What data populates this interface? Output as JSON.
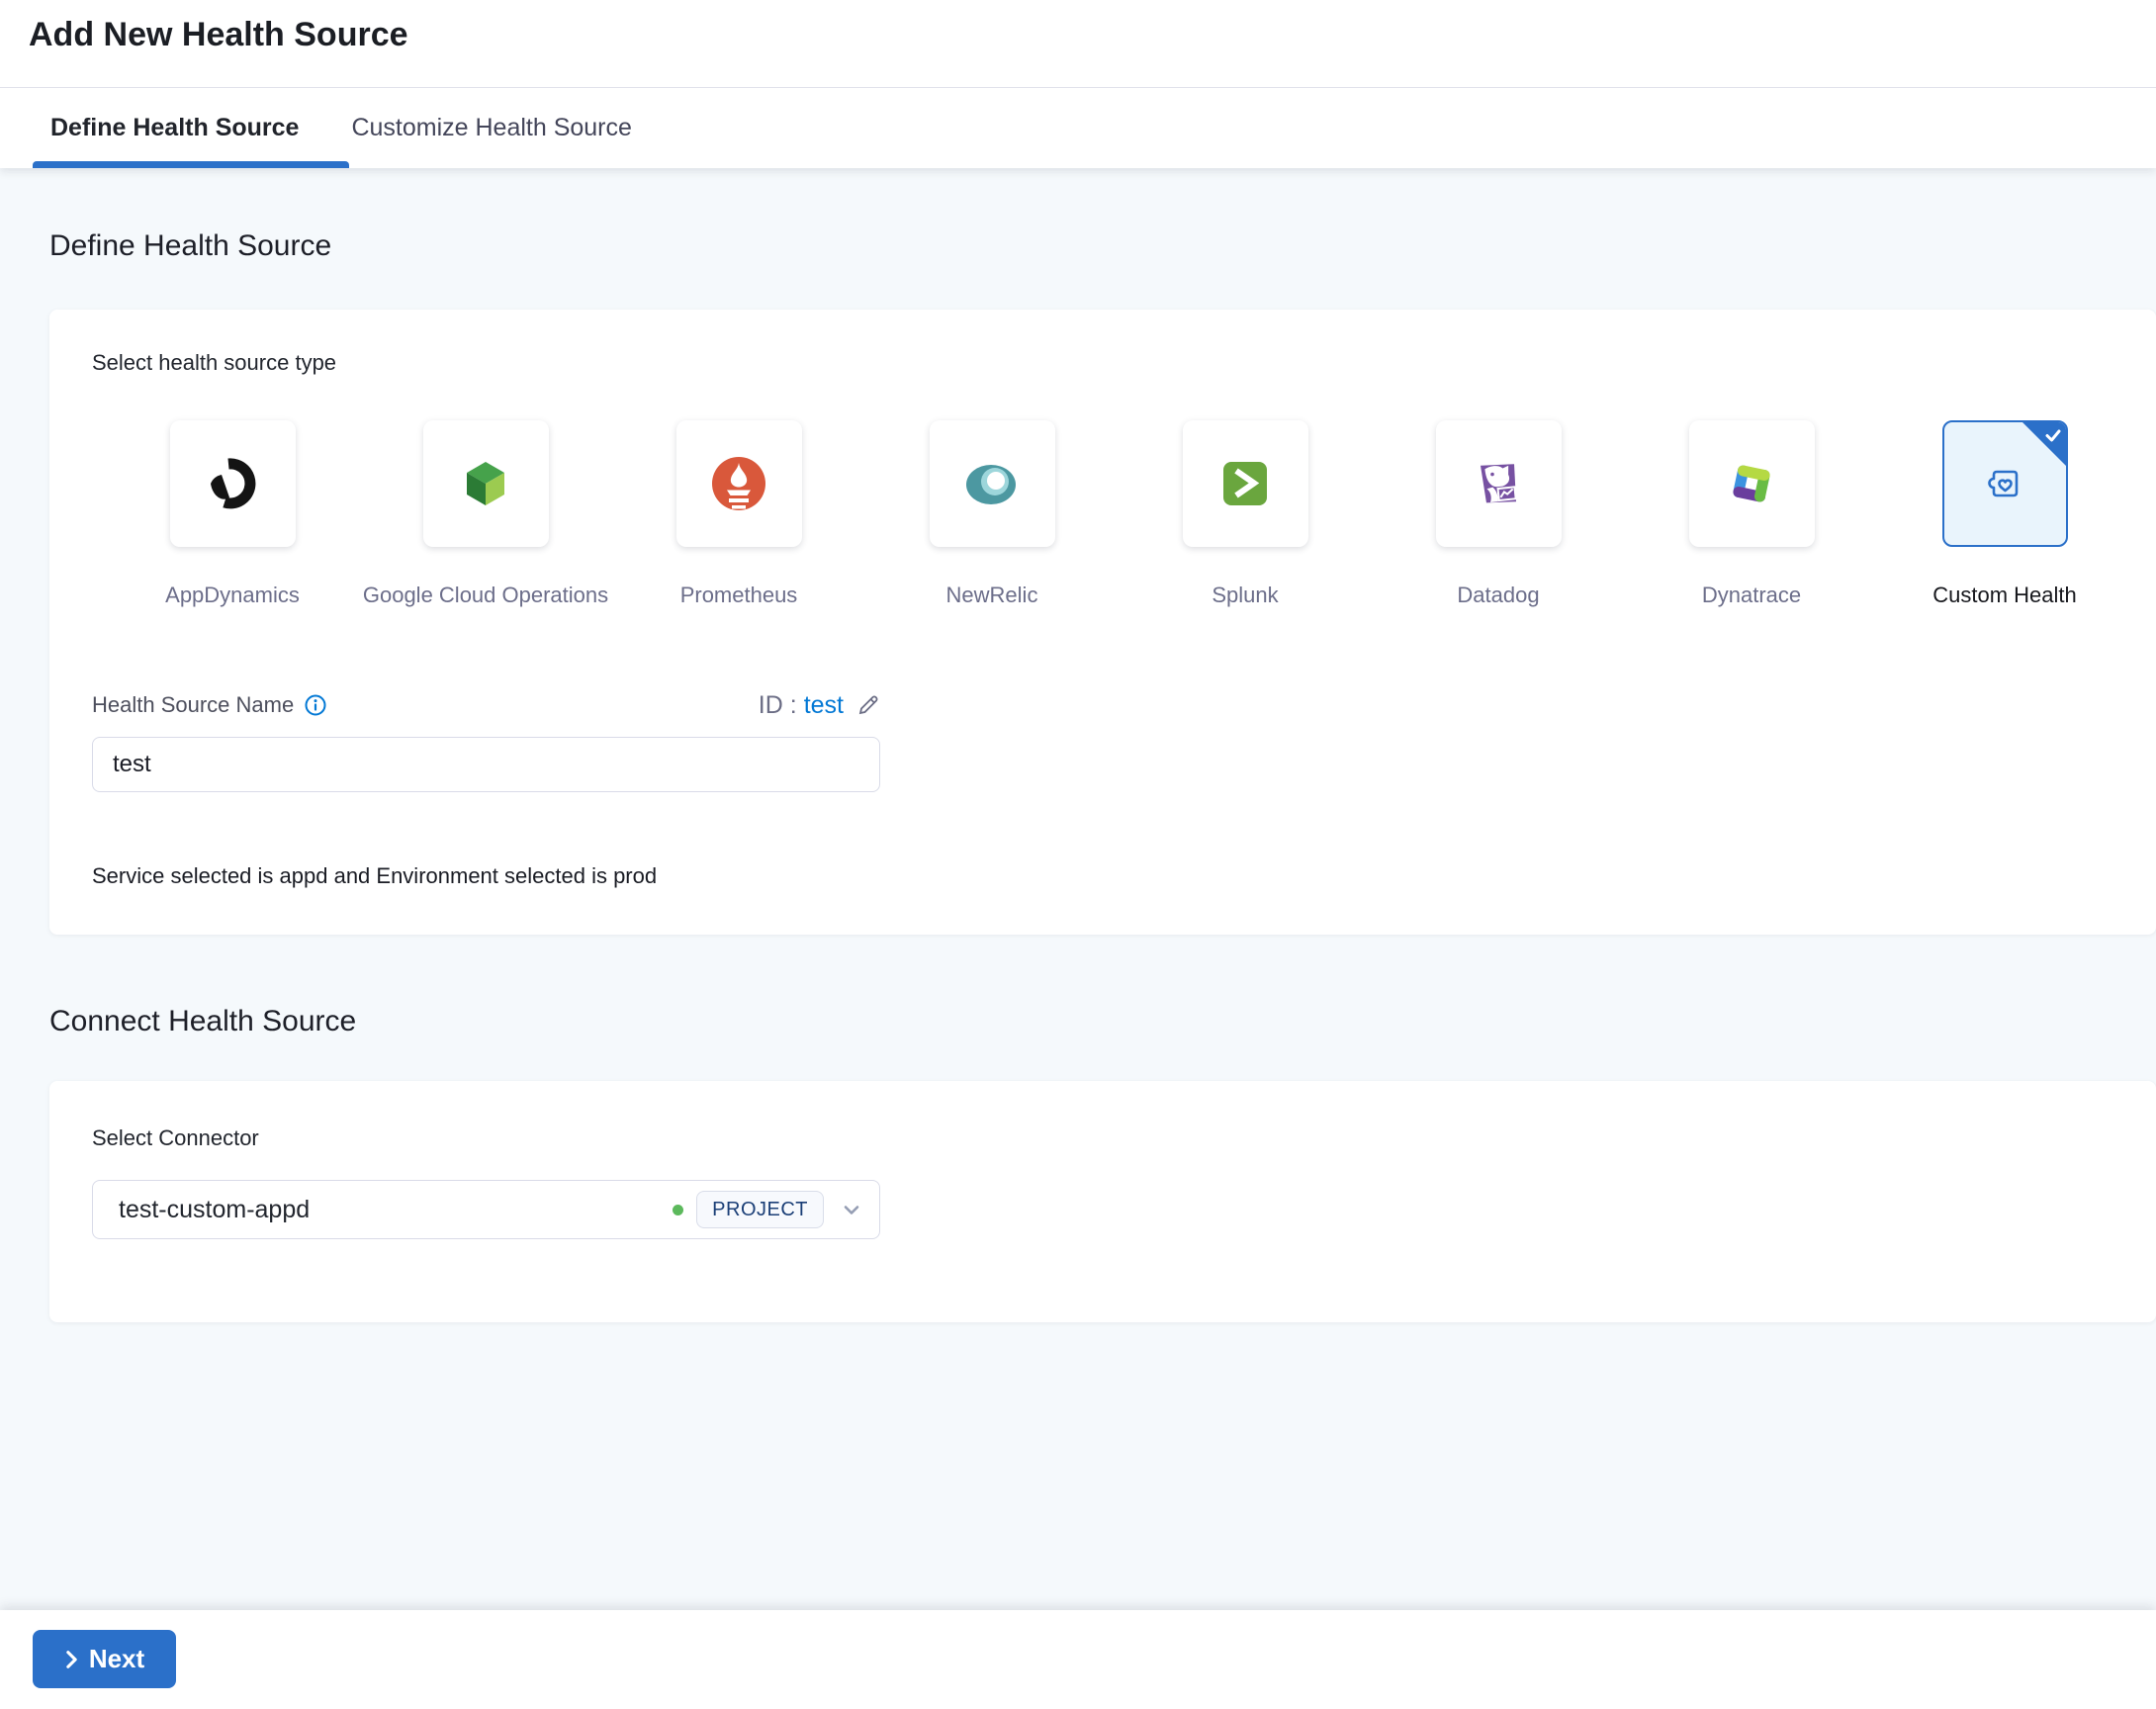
{
  "header": {
    "title": "Add New Health Source",
    "tabs": [
      {
        "label": "Define Health Source",
        "active": true
      },
      {
        "label": "Customize Health Source",
        "active": false
      }
    ]
  },
  "define_section": {
    "heading": "Define Health Source",
    "select_type_label": "Select health source type",
    "sources": [
      {
        "label": "AppDynamics",
        "icon": "appdynamics-icon",
        "selected": false
      },
      {
        "label": "Google Cloud Operations",
        "icon": "google-cloud-operations-icon",
        "selected": false
      },
      {
        "label": "Prometheus",
        "icon": "prometheus-icon",
        "selected": false
      },
      {
        "label": "NewRelic",
        "icon": "newrelic-icon",
        "selected": false
      },
      {
        "label": "Splunk",
        "icon": "splunk-icon",
        "selected": false
      },
      {
        "label": "Datadog",
        "icon": "datadog-icon",
        "selected": false
      },
      {
        "label": "Dynatrace",
        "icon": "dynatrace-icon",
        "selected": false
      },
      {
        "label": "Custom Health",
        "icon": "custom-health-icon",
        "selected": true
      }
    ],
    "name_label": "Health Source Name",
    "id_label": "ID",
    "id_separator": ":",
    "id_value": "test",
    "name_value": "test",
    "service_env_note": "Service selected is appd and Environment selected is prod"
  },
  "connect_section": {
    "heading": "Connect Health Source",
    "select_connector_label": "Select Connector",
    "connector": {
      "value": "test-custom-appd",
      "scope_badge": "PROJECT"
    }
  },
  "footer": {
    "next_label": "Next"
  },
  "colors": {
    "accent_blue": "#2b70c9",
    "link_blue": "#0278d5",
    "status_green": "#5cb95c",
    "content_background": "#f5f9fc"
  }
}
